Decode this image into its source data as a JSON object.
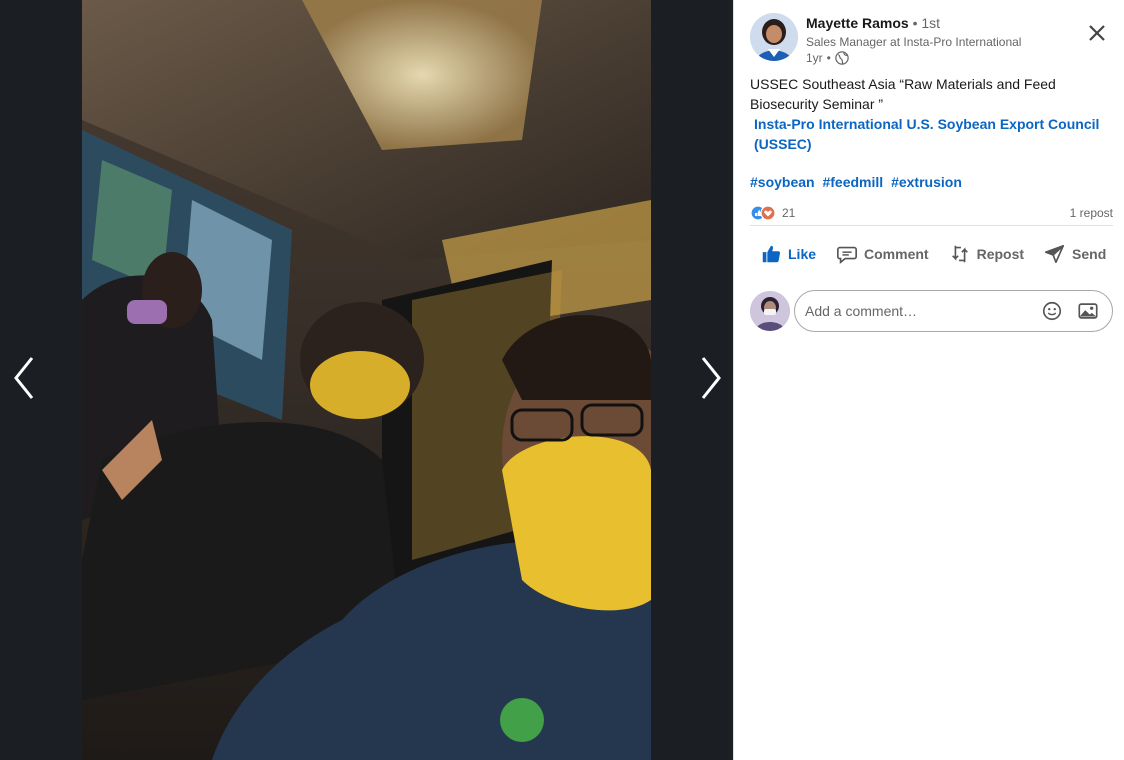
{
  "author": {
    "name": "Mayette Ramos",
    "separator": "•",
    "degree": "1st",
    "headline": "Sales Manager at Insta-Pro International",
    "time": "1yr",
    "visibility_icon": "globe-icon"
  },
  "post": {
    "text": "USSEC Southeast Asia “Raw Materials and Feed Biosecurity Seminar ”",
    "mentions": "Insta-Pro International U.S. Soybean Export Council (USSEC)",
    "hashtags": [
      "#soybean",
      "#feedmill",
      "#extrusion"
    ]
  },
  "social": {
    "reaction_count": "21",
    "reposts": "1 repost"
  },
  "actions": {
    "like": "Like",
    "comment": "Comment",
    "repost": "Repost",
    "send": "Send"
  },
  "comment_box": {
    "placeholder": "Add a comment…"
  },
  "colors": {
    "link": "#0a66c2",
    "viewer_bg": "#1b1f23"
  }
}
